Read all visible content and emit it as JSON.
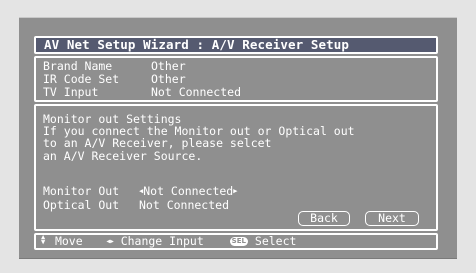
{
  "header": {
    "title": "AV Net Setup Wizard : A/V Receiver Setup"
  },
  "info": {
    "rows": [
      {
        "label": "Brand Name",
        "value": "Other"
      },
      {
        "label": "IR Code Set",
        "value": "Other"
      },
      {
        "label": "TV Input",
        "value": "Not Connected"
      }
    ]
  },
  "settings": {
    "heading": "Monitor out Settings",
    "message_lines": [
      "If you connect the Monitor out or Optical out",
      "to an A/V Receiver, please selcet",
      "an A/V Receiver Source."
    ],
    "monitor_out": {
      "label": "Monitor Out",
      "value": "Not Connected"
    },
    "optical_out": {
      "label": "Optical Out",
      "value": "Not Connected"
    },
    "back_label": "Back",
    "next_label": "Next"
  },
  "help": {
    "move": "Move",
    "change_input": "Change Input",
    "sel_badge": "SEL",
    "select": "Select",
    "icons": [
      "up-down-arrows-icon",
      "left-right-arrows-icon",
      "sel-button-icon"
    ]
  },
  "colors": {
    "screen_bg": "#8f8f8f",
    "title_bar": "#555a70",
    "text": "#ffffff",
    "page_bg": "#e4e4e4"
  }
}
